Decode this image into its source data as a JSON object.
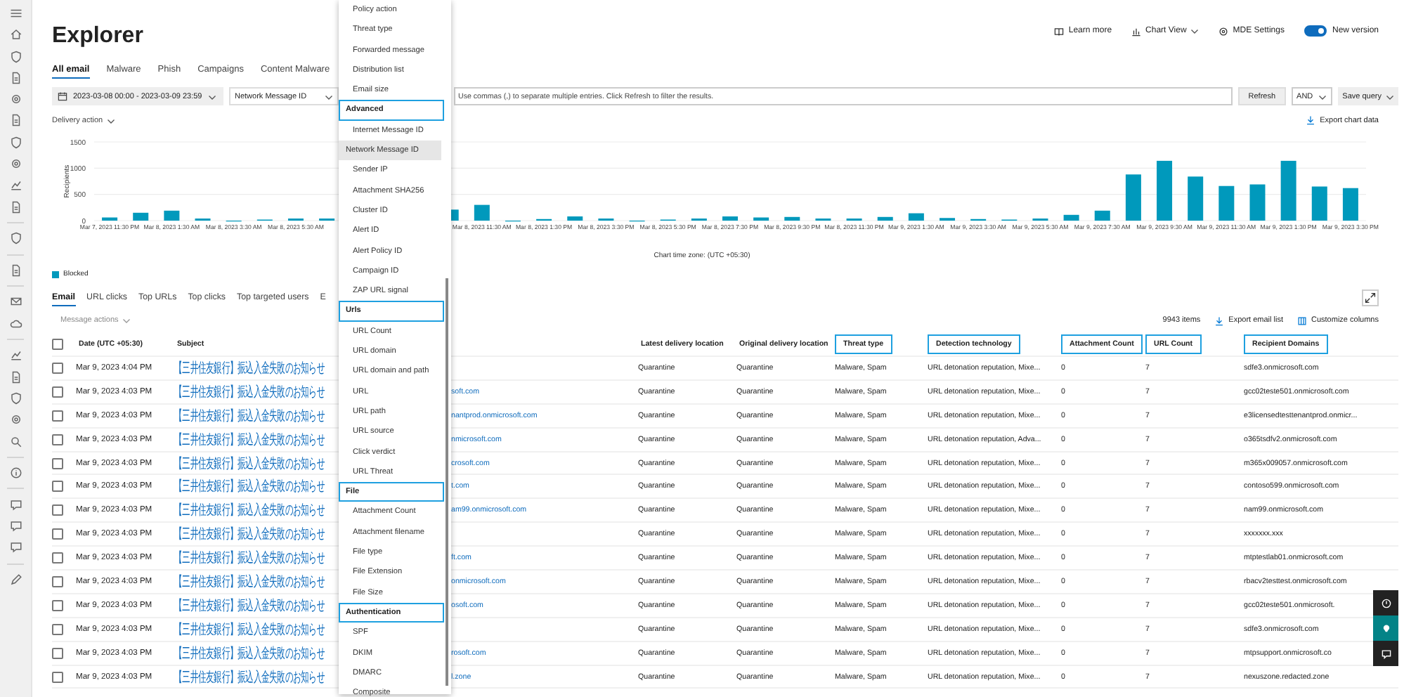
{
  "header": {
    "title": "Explorer",
    "actions": [
      {
        "kind": "learn",
        "label": "Learn more"
      },
      {
        "kind": "chart",
        "label": "Chart View"
      },
      {
        "kind": "settings",
        "label": "MDE Settings"
      }
    ],
    "toggle": {
      "label": "New version",
      "on": true
    }
  },
  "tabs": [
    {
      "label": "All email",
      "selected": true
    },
    {
      "label": "Malware",
      "selected": false
    },
    {
      "label": "Phish",
      "selected": false
    },
    {
      "label": "Campaigns",
      "selected": false
    },
    {
      "label": "Content Malware",
      "selected": false
    }
  ],
  "filters": {
    "date_range": "2023-03-08 00:00 - 2023-03-09 23:59",
    "attribute": "Network Message ID",
    "query": {
      "placeholder": "Use commas (,) to separate multiple entries. Click Refresh to filter the results."
    },
    "refresh": "Refresh",
    "operator": "AND",
    "save": "Save query"
  },
  "chart_section": {
    "filter": "Delivery action",
    "export": "Export chart data",
    "chart_data": {
      "type": "bar",
      "xlabel": "Chart time zone: (UTC +05:30)",
      "ylabel": "Recipients",
      "ylim": [
        0,
        1500
      ],
      "yticks": [
        0,
        500,
        1000,
        1500
      ],
      "categories": [
        "Mar 7, 2023 11:30 PM",
        null,
        "Mar 8, 2023 1:30 AM",
        null,
        "Mar 8, 2023 3:30 AM",
        null,
        "Mar 8, 2023 5:30 AM",
        null,
        null,
        null,
        null,
        null,
        "Mar 8, 2023 11:30 AM",
        null,
        "Mar 8, 2023 1:30 PM",
        null,
        "Mar 8, 2023 3:30 PM",
        null,
        "Mar 8, 2023 5:30 PM",
        null,
        "Mar 8, 2023 7:30 PM",
        null,
        "Mar 8, 2023 9:30 PM",
        null,
        "Mar 8, 2023 11:30 PM",
        null,
        "Mar 9, 2023 1:30 AM",
        null,
        "Mar 9, 2023 3:30 AM",
        null,
        "Mar 9, 2023 5:30 AM",
        null,
        "Mar 9, 2023 7:30 AM",
        null,
        "Mar 9, 2023 9:30 AM",
        null,
        "Mar 9, 2023 11:30 AM",
        null,
        "Mar 9, 2023 1:30 PM",
        null,
        "Mar 9, 2023 3:30 PM"
      ],
      "series": [
        {
          "name": "Blocked",
          "color": "#0099bc",
          "values": [
            60,
            150,
            190,
            40,
            0,
            20,
            40,
            40,
            null,
            null,
            null,
            210,
            300,
            0,
            30,
            80,
            40,
            0,
            20,
            40,
            80,
            60,
            70,
            40,
            40,
            70,
            140,
            50,
            30,
            20,
            40,
            110,
            190,
            880,
            1140,
            840,
            660,
            690,
            1140,
            650,
            620
          ]
        }
      ]
    }
  },
  "result_tabs": [
    {
      "label": "Email",
      "selected": true
    },
    {
      "label": "URL clicks",
      "selected": false
    },
    {
      "label": "Top URLs",
      "selected": false
    },
    {
      "label": "Top clicks",
      "selected": false
    },
    {
      "label": "Top targeted users",
      "selected": false
    },
    {
      "label": "E",
      "selected": false
    }
  ],
  "toolbar": {
    "message_actions": "Message actions",
    "count": "9943 items",
    "export": "Export email list",
    "customize": "Customize columns"
  },
  "table": {
    "all_checked": false,
    "columns": [
      {
        "label": "Date (UTC +05:30)",
        "highlighted": false
      },
      {
        "label": "Subject",
        "highlighted": false
      },
      {
        "label": "Latest delivery location",
        "highlighted": false
      },
      {
        "label": "Original delivery location",
        "highlighted": false
      },
      {
        "label": "Threat type",
        "highlighted": true
      },
      {
        "label": "Detection technology",
        "highlighted": true
      },
      {
        "label": "Attachment Count",
        "highlighted": true
      },
      {
        "label": "URL Count",
        "highlighted": true
      },
      {
        "label": "Recipient Domains",
        "highlighted": true
      }
    ],
    "rows": [
      {
        "checked": false,
        "date": "Mar 9, 2023 4:04 PM",
        "subject": "【三井住友銀行】振込入金失敗のお知らせ",
        "latest": "Quarantine",
        "original": "Quarantine",
        "threat": "Malware, Spam",
        "detection": "URL detonation reputation, Mixe...",
        "attachments": "0",
        "urls": "7",
        "recipient": "sdfe3.onmicrosoft.com"
      },
      {
        "date": "Mar 9, 2023 4:03 PM",
        "subject": "【三井住友銀行】振込入金失敗のお知らせ",
        "sender": "soft.com",
        "latest": "Quarantine",
        "original": "Quarantine",
        "threat": "Malware, Spam",
        "detection": "URL detonation reputation, Mixe...",
        "attachments": "0",
        "urls": "7",
        "recipient": "gcc02teste501.onmicrosoft.com",
        "checked": false
      },
      {
        "date": "Mar 9, 2023 4:03 PM",
        "subject": "【三井住友銀行】振込入金失敗のお知らせ",
        "sender": "nantprod.onmicrosoft.com",
        "latest": "Quarantine",
        "original": "Quarantine",
        "threat": "Malware, Spam",
        "detection": "URL detonation reputation, Mixe...",
        "attachments": "0",
        "urls": "7",
        "recipient": "e3licensedtesttenantprod.onmicr...",
        "checked": false
      },
      {
        "date": "Mar 9, 2023 4:03 PM",
        "subject": "【三井住友銀行】振込入金失敗のお知らせ",
        "sender": "nmicrosoft.com",
        "latest": "Quarantine",
        "original": "Quarantine",
        "threat": "Malware, Spam",
        "detection": "URL detonation reputation, Adva...",
        "attachments": "0",
        "urls": "7",
        "recipient": "o365tsdfv2.onmicrosoft.com",
        "checked": false
      },
      {
        "date": "Mar 9, 2023 4:03 PM",
        "subject": "【三井住友銀行】振込入金失敗のお知らせ",
        "sender": "crosoft.com",
        "latest": "Quarantine",
        "original": "Quarantine",
        "threat": "Malware, Spam",
        "detection": "URL detonation reputation, Mixe...",
        "attachments": "0",
        "urls": "7",
        "recipient": "m365x009057.onmicrosoft.com",
        "checked": false
      },
      {
        "date": "Mar 9, 2023 4:03 PM",
        "subject": "【三井住友銀行】振込入金失敗のお知らせ",
        "sender": "t.com",
        "latest": "Quarantine",
        "original": "Quarantine",
        "threat": "Malware, Spam",
        "detection": "URL detonation reputation, Mixe...",
        "attachments": "0",
        "urls": "7",
        "recipient": "contoso599.onmicrosoft.com",
        "checked": false
      },
      {
        "date": "Mar 9, 2023 4:03 PM",
        "subject": "【三井住友銀行】振込入金失敗のお知らせ",
        "sender": "am99.onmicrosoft.com",
        "latest": "Quarantine",
        "original": "Quarantine",
        "threat": "Malware, Spam",
        "detection": "URL detonation reputation, Mixe...",
        "attachments": "0",
        "urls": "7",
        "recipient": "nam99.onmicrosoft.com",
        "checked": false
      },
      {
        "date": "Mar 9, 2023 4:03 PM",
        "subject": "【三井住友銀行】振込入金失敗のお知らせ",
        "latest": "Quarantine",
        "original": "Quarantine",
        "threat": "Malware, Spam",
        "detection": "URL detonation reputation, Mixe...",
        "attachments": "0",
        "urls": "7",
        "recipient": "xxxxxxx.xxx",
        "checked": false
      },
      {
        "date": "Mar 9, 2023 4:03 PM",
        "subject": "【三井住友銀行】振込入金失敗のお知らせ",
        "sender": "ft.com",
        "latest": "Quarantine",
        "original": "Quarantine",
        "threat": "Malware, Spam",
        "detection": "URL detonation reputation, Mixe...",
        "attachments": "0",
        "urls": "7",
        "recipient": "mtptestlab01.onmicrosoft.com",
        "checked": false
      },
      {
        "date": "Mar 9, 2023 4:03 PM",
        "subject": "【三井住友銀行】振込入金失敗のお知らせ",
        "sender": "onmicrosoft.com",
        "latest": "Quarantine",
        "original": "Quarantine",
        "threat": "Malware, Spam",
        "detection": "URL detonation reputation, Mixe...",
        "attachments": "0",
        "urls": "7",
        "recipient": "rbacv2testtest.onmicrosoft.com",
        "checked": false
      },
      {
        "date": "Mar 9, 2023 4:03 PM",
        "subject": "【三井住友銀行】振込入金失敗のお知らせ",
        "sender": "osoft.com",
        "latest": "Quarantine",
        "original": "Quarantine",
        "threat": "Malware, Spam",
        "detection": "URL detonation reputation, Mixe...",
        "attachments": "0",
        "urls": "7",
        "recipient": "gcc02teste501.onmicrosoft.",
        "checked": false
      },
      {
        "date": "Mar 9, 2023 4:03 PM",
        "subject": "【三井住友銀行】振込入金失敗のお知らせ",
        "latest": "Quarantine",
        "original": "Quarantine",
        "threat": "Malware, Spam",
        "detection": "URL detonation reputation, Mixe...",
        "attachments": "0",
        "urls": "7",
        "recipient": "sdfe3.onmicrosoft.com",
        "checked": false
      },
      {
        "date": "Mar 9, 2023 4:03 PM",
        "subject": "【三井住友銀行】振込入金失敗のお知らせ",
        "sender": "rosoft.com",
        "latest": "Quarantine",
        "original": "Quarantine",
        "threat": "Malware, Spam",
        "detection": "URL detonation reputation, Mixe...",
        "attachments": "0",
        "urls": "7",
        "recipient": "mtpsupport.onmicrosoft.co",
        "checked": false
      },
      {
        "date": "Mar 9, 2023 4:03 PM",
        "subject": "【三井住友銀行】振込入金失敗のお知らせ",
        "sender": "l.zone",
        "latest": "Quarantine",
        "original": "Quarantine",
        "threat": "Malware, Spam",
        "detection": "URL detonation reputation, Mixe...",
        "attachments": "0",
        "urls": "7",
        "recipient": "nexuszone.redacted.zone",
        "checked": false
      }
    ]
  },
  "dropdown": {
    "items": [
      {
        "kind": "option",
        "label": "Policy action",
        "selected": false
      },
      {
        "kind": "option",
        "label": "Threat type",
        "selected": false
      },
      {
        "kind": "option",
        "label": "Forwarded message",
        "selected": false
      },
      {
        "kind": "option",
        "label": "Distribution list",
        "selected": false
      },
      {
        "kind": "option",
        "label": "Email size",
        "selected": false
      },
      {
        "kind": "group",
        "label": "Advanced"
      },
      {
        "kind": "option",
        "label": "Internet Message ID",
        "selected": false
      },
      {
        "kind": "option",
        "label": "Network Message ID",
        "selected": true
      },
      {
        "kind": "option",
        "label": "Sender IP",
        "selected": false
      },
      {
        "kind": "option",
        "label": "Attachment SHA256",
        "selected": false
      },
      {
        "kind": "option",
        "label": "Cluster ID",
        "selected": false
      },
      {
        "kind": "option",
        "label": "Alert ID",
        "selected": false
      },
      {
        "kind": "option",
        "label": "Alert Policy ID",
        "selected": false
      },
      {
        "kind": "option",
        "label": "Campaign ID",
        "selected": false
      },
      {
        "kind": "option",
        "label": "ZAP URL signal",
        "selected": false
      },
      {
        "kind": "group",
        "label": "Urls"
      },
      {
        "kind": "option",
        "label": "URL Count",
        "selected": false
      },
      {
        "kind": "option",
        "label": "URL domain",
        "selected": false
      },
      {
        "kind": "option",
        "label": "URL domain and path",
        "selected": false
      },
      {
        "kind": "option",
        "label": "URL",
        "selected": false
      },
      {
        "kind": "option",
        "label": "URL path",
        "selected": false
      },
      {
        "kind": "option",
        "label": "URL source",
        "selected": false
      },
      {
        "kind": "option",
        "label": "Click verdict",
        "selected": false
      },
      {
        "kind": "option",
        "label": "URL Threat",
        "selected": false
      },
      {
        "kind": "group",
        "label": "File"
      },
      {
        "kind": "option",
        "label": "Attachment Count",
        "selected": false
      },
      {
        "kind": "option",
        "label": "Attachment filename",
        "selected": false
      },
      {
        "kind": "option",
        "label": "File type",
        "selected": false
      },
      {
        "kind": "option",
        "label": "File Extension",
        "selected": false
      },
      {
        "kind": "option",
        "label": "File Size",
        "selected": false
      },
      {
        "kind": "group",
        "label": "Authentication"
      },
      {
        "kind": "option",
        "label": "SPF",
        "selected": false
      },
      {
        "kind": "option",
        "label": "DKIM",
        "selected": false
      },
      {
        "kind": "option",
        "label": "DMARC",
        "selected": false
      },
      {
        "kind": "option",
        "label": "Composite",
        "selected": false
      }
    ]
  }
}
